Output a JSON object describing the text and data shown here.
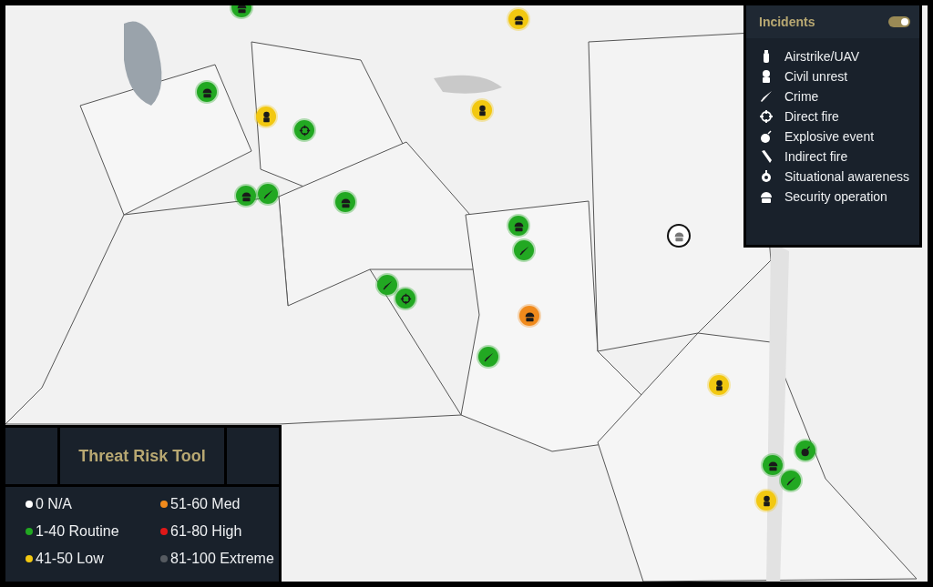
{
  "incidents_panel": {
    "title": "Incidents",
    "toggle": {
      "on": true
    },
    "items": [
      {
        "kind": "airstrike",
        "label": "Airstrike/UAV"
      },
      {
        "kind": "civil",
        "label": "Civil unrest"
      },
      {
        "kind": "crime",
        "label": "Crime"
      },
      {
        "kind": "directfire",
        "label": "Direct fire"
      },
      {
        "kind": "explosive",
        "label": "Explosive event"
      },
      {
        "kind": "indirect",
        "label": "Indirect fire"
      },
      {
        "kind": "awareness",
        "label": "Situational awareness"
      },
      {
        "kind": "security",
        "label": "Security operation"
      }
    ]
  },
  "map": {
    "markers": [
      {
        "kind": "security",
        "color": "#22a822"
      },
      {
        "kind": "security",
        "color": "#f2c811"
      },
      {
        "kind": "security",
        "color": "#22a822"
      },
      {
        "kind": "civil",
        "color": "#f2c811"
      },
      {
        "kind": "directfire",
        "color": "#22a822"
      },
      {
        "kind": "civil",
        "color": "#f2c811"
      },
      {
        "kind": "security",
        "color": "#22a822"
      },
      {
        "kind": "crime",
        "color": "#22a822"
      },
      {
        "kind": "security",
        "color": "#22a822"
      },
      {
        "kind": "security",
        "color": "#22a822"
      },
      {
        "kind": "crime",
        "color": "#22a822"
      },
      {
        "kind": "crime",
        "color": "#22a822"
      },
      {
        "kind": "directfire",
        "color": "#22a822"
      },
      {
        "kind": "security",
        "color": "#f08a1c"
      },
      {
        "kind": "crime",
        "color": "#22a822"
      },
      {
        "kind": "security",
        "color": "#ffffff"
      },
      {
        "kind": "civil",
        "color": "#f2c811"
      },
      {
        "kind": "explosive",
        "color": "#22a822"
      },
      {
        "kind": "security",
        "color": "#22a822"
      },
      {
        "kind": "crime",
        "color": "#22a822"
      },
      {
        "kind": "civil",
        "color": "#f2c811"
      }
    ]
  },
  "threat_panel": {
    "title": "Threat Risk Tool",
    "levels": [
      {
        "label": "0 N/A",
        "color": "#ffffff"
      },
      {
        "label": "51-60 Med",
        "color": "#f08a1c"
      },
      {
        "label": "1-40 Routine",
        "color": "#22a822"
      },
      {
        "label": "61-80 High",
        "color": "#e01818"
      },
      {
        "label": "41-50 Low",
        "color": "#f2c811"
      },
      {
        "label": "81-100 Extreme",
        "color": "#555a60"
      }
    ]
  }
}
